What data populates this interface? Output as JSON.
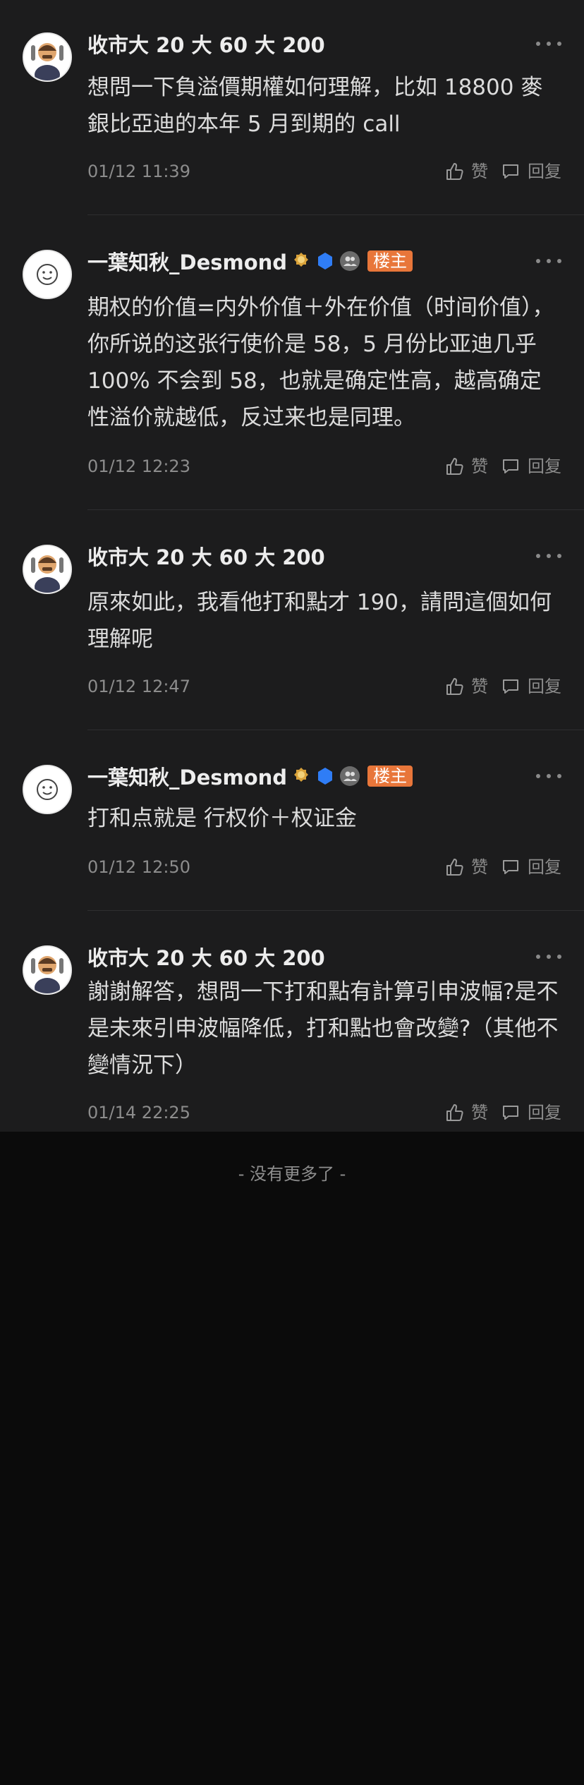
{
  "comments": [
    {
      "user": "收市大 20 大 60 大 200",
      "text": "想問一下負溢價期權如何理解，比如 18800 麥銀比亞迪的本年 5 月到期的 call",
      "time": "01/12 11:39",
      "like_label": "赞",
      "reply_label": "回复",
      "is_owner": false
    },
    {
      "user": "一葉知秋_Desmond",
      "owner_tag": "楼主",
      "text": "期权的价值=内外价值＋外在价值（时间价值），你所说的这张行使价是 58，5 月份比亚迪几乎 100% 不会到 58，也就是确定性高，越高确定性溢价就越低，反过来也是同理。",
      "time": "01/12 12:23",
      "like_label": "赞",
      "reply_label": "回复",
      "is_owner": true
    },
    {
      "user": "收市大 20 大 60 大 200",
      "text": "原來如此，我看他打和點才 190，請問這個如何理解呢",
      "time": "01/12 12:47",
      "like_label": "赞",
      "reply_label": "回复",
      "is_owner": false
    },
    {
      "user": "一葉知秋_Desmond",
      "owner_tag": "楼主",
      "text": "打和点就是 行权价＋权证金",
      "time": "01/12 12:50",
      "like_label": "赞",
      "reply_label": "回复",
      "is_owner": true
    },
    {
      "user": "收市大 20 大 60 大 200",
      "text": "謝謝解答，想問一下打和點有計算引申波幅?是不是未來引申波幅降低，打和點也會改變?（其他不變情況下）",
      "time": "01/14 22:25",
      "like_label": "赞",
      "reply_label": "回复",
      "is_owner": false
    }
  ],
  "footer": "- 没有更多了 -",
  "colors": {
    "background": "#1c1c1d",
    "page_bottom": "#0b0b0b",
    "owner_tag": "#e8763a",
    "badge_gold": "#d9a23a",
    "badge_blue": "#2f7df6",
    "badge_gray": "#6b6b6b"
  },
  "icons": [
    "thumbs-up-icon",
    "comment-icon",
    "more-dots-icon",
    "gold-medal-badge-icon",
    "blue-level-badge-icon",
    "group-badge-icon"
  ]
}
